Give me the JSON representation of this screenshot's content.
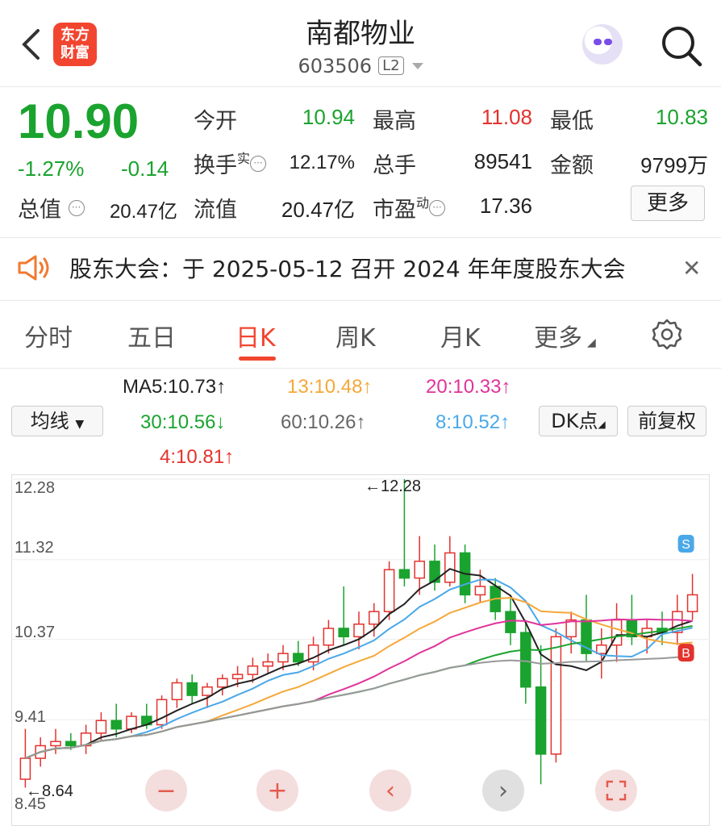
{
  "header": {
    "title": "南都物业",
    "code": "603506",
    "level_tag": "L2",
    "logo_line1": "东方",
    "logo_line2": "财富"
  },
  "quote": {
    "price": "10.90",
    "pct_change": "-1.27%",
    "change": "-0.14",
    "fields": {
      "open_label": "今开",
      "open": "10.94",
      "high_label": "最高",
      "high": "11.08",
      "low_label": "最低",
      "low": "10.83",
      "turnover_label": "换手",
      "turnover_sup": "实",
      "turnover": "12.17%",
      "volume_label": "总手",
      "volume": "89541",
      "amount_label": "金额",
      "amount": "9799万",
      "mktcap_label": "总值",
      "mktcap": "20.47亿",
      "float_label": "流值",
      "float": "20.47亿",
      "pe_label": "市盈",
      "pe_sup": "动",
      "pe": "17.36"
    },
    "more_label": "更多"
  },
  "notice": {
    "text": "股东大会：于 2025-05-12 召开 2024 年年度股东大会"
  },
  "tabs": [
    "分时",
    "五日",
    "日K",
    "周K",
    "月K",
    "更多"
  ],
  "ma": {
    "selector": "均线",
    "ma5": "MA5:10.73↑",
    "ma13": "13:10.48↑",
    "ma20": "20:10.33↑",
    "ma30": "30:10.56↓",
    "ma60": "60:10.26↑",
    "ma8": "8:10.52↑",
    "ma4": "4:10.81↑",
    "dk_label": "DK点",
    "adjust_label": "前复权"
  },
  "chart_data": {
    "type": "candlestick",
    "y_ticks": [
      "12.28",
      "11.32",
      "10.37",
      "9.41",
      "8.45"
    ],
    "ylim": [
      8.45,
      12.28
    ],
    "annotations": {
      "max": "12.28",
      "min": "8.64",
      "buy_marker": "B",
      "sell_marker": "S"
    },
    "candles": [
      [
        8.7,
        9.3,
        8.6,
        8.95
      ],
      [
        8.95,
        9.2,
        8.85,
        9.1
      ],
      [
        9.1,
        9.3,
        9.0,
        9.15
      ],
      [
        9.15,
        9.25,
        9.05,
        9.1
      ],
      [
        9.1,
        9.35,
        9.0,
        9.25
      ],
      [
        9.25,
        9.5,
        9.15,
        9.4
      ],
      [
        9.4,
        9.6,
        9.2,
        9.3
      ],
      [
        9.3,
        9.5,
        9.25,
        9.45
      ],
      [
        9.45,
        9.6,
        9.3,
        9.35
      ],
      [
        9.35,
        9.7,
        9.3,
        9.65
      ],
      [
        9.65,
        9.9,
        9.55,
        9.85
      ],
      [
        9.85,
        9.95,
        9.6,
        9.7
      ],
      [
        9.7,
        9.85,
        9.55,
        9.8
      ],
      [
        9.8,
        9.95,
        9.7,
        9.9
      ],
      [
        9.9,
        10.05,
        9.8,
        9.95
      ],
      [
        9.95,
        10.15,
        9.85,
        10.05
      ],
      [
        10.05,
        10.2,
        9.95,
        10.1
      ],
      [
        10.1,
        10.3,
        10.0,
        10.2
      ],
      [
        10.2,
        10.35,
        10.05,
        10.1
      ],
      [
        10.1,
        10.4,
        10.0,
        10.3
      ],
      [
        10.3,
        10.6,
        10.2,
        10.5
      ],
      [
        10.5,
        11.0,
        10.3,
        10.4
      ],
      [
        10.4,
        10.7,
        10.25,
        10.55
      ],
      [
        10.55,
        10.8,
        10.4,
        10.7
      ],
      [
        10.7,
        11.3,
        10.6,
        11.2
      ],
      [
        11.2,
        12.28,
        11.0,
        11.1
      ],
      [
        11.1,
        11.6,
        10.9,
        11.3
      ],
      [
        11.3,
        11.5,
        10.95,
        11.05
      ],
      [
        11.05,
        11.6,
        11.0,
        11.4
      ],
      [
        11.4,
        11.5,
        10.8,
        10.9
      ],
      [
        10.9,
        11.2,
        10.8,
        11.0
      ],
      [
        11.0,
        11.1,
        10.6,
        10.7
      ],
      [
        10.7,
        10.9,
        10.3,
        10.45
      ],
      [
        10.45,
        10.6,
        9.6,
        9.8
      ],
      [
        9.8,
        10.3,
        8.64,
        9.0
      ],
      [
        9.0,
        10.5,
        8.9,
        10.4
      ],
      [
        10.4,
        10.7,
        10.2,
        10.6
      ],
      [
        10.6,
        10.9,
        10.1,
        10.2
      ],
      [
        10.2,
        10.5,
        9.9,
        10.3
      ],
      [
        10.3,
        10.8,
        10.1,
        10.6
      ],
      [
        10.6,
        10.9,
        10.3,
        10.4
      ],
      [
        10.4,
        10.6,
        10.2,
        10.5
      ],
      [
        10.5,
        10.7,
        10.3,
        10.45
      ],
      [
        10.45,
        10.9,
        10.3,
        10.7
      ],
      [
        10.7,
        11.15,
        10.6,
        10.9
      ]
    ]
  },
  "controls": {
    "zoom_out": "−",
    "zoom_in": "+",
    "prev": "‹",
    "next": "›"
  }
}
